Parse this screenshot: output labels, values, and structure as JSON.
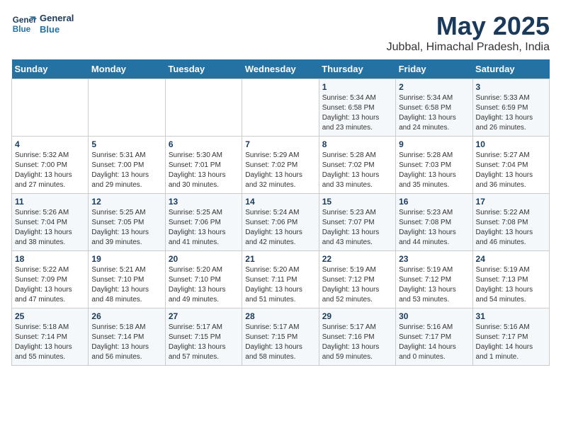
{
  "header": {
    "logo_line1": "General",
    "logo_line2": "Blue",
    "title": "May 2025",
    "subtitle": "Jubbal, Himachal Pradesh, India"
  },
  "calendar": {
    "days_of_week": [
      "Sunday",
      "Monday",
      "Tuesday",
      "Wednesday",
      "Thursday",
      "Friday",
      "Saturday"
    ],
    "weeks": [
      [
        {
          "day": "",
          "info": ""
        },
        {
          "day": "",
          "info": ""
        },
        {
          "day": "",
          "info": ""
        },
        {
          "day": "",
          "info": ""
        },
        {
          "day": "1",
          "info": "Sunrise: 5:34 AM\nSunset: 6:58 PM\nDaylight: 13 hours\nand 23 minutes."
        },
        {
          "day": "2",
          "info": "Sunrise: 5:34 AM\nSunset: 6:58 PM\nDaylight: 13 hours\nand 24 minutes."
        },
        {
          "day": "3",
          "info": "Sunrise: 5:33 AM\nSunset: 6:59 PM\nDaylight: 13 hours\nand 26 minutes."
        }
      ],
      [
        {
          "day": "4",
          "info": "Sunrise: 5:32 AM\nSunset: 7:00 PM\nDaylight: 13 hours\nand 27 minutes."
        },
        {
          "day": "5",
          "info": "Sunrise: 5:31 AM\nSunset: 7:00 PM\nDaylight: 13 hours\nand 29 minutes."
        },
        {
          "day": "6",
          "info": "Sunrise: 5:30 AM\nSunset: 7:01 PM\nDaylight: 13 hours\nand 30 minutes."
        },
        {
          "day": "7",
          "info": "Sunrise: 5:29 AM\nSunset: 7:02 PM\nDaylight: 13 hours\nand 32 minutes."
        },
        {
          "day": "8",
          "info": "Sunrise: 5:28 AM\nSunset: 7:02 PM\nDaylight: 13 hours\nand 33 minutes."
        },
        {
          "day": "9",
          "info": "Sunrise: 5:28 AM\nSunset: 7:03 PM\nDaylight: 13 hours\nand 35 minutes."
        },
        {
          "day": "10",
          "info": "Sunrise: 5:27 AM\nSunset: 7:04 PM\nDaylight: 13 hours\nand 36 minutes."
        }
      ],
      [
        {
          "day": "11",
          "info": "Sunrise: 5:26 AM\nSunset: 7:04 PM\nDaylight: 13 hours\nand 38 minutes."
        },
        {
          "day": "12",
          "info": "Sunrise: 5:25 AM\nSunset: 7:05 PM\nDaylight: 13 hours\nand 39 minutes."
        },
        {
          "day": "13",
          "info": "Sunrise: 5:25 AM\nSunset: 7:06 PM\nDaylight: 13 hours\nand 41 minutes."
        },
        {
          "day": "14",
          "info": "Sunrise: 5:24 AM\nSunset: 7:06 PM\nDaylight: 13 hours\nand 42 minutes."
        },
        {
          "day": "15",
          "info": "Sunrise: 5:23 AM\nSunset: 7:07 PM\nDaylight: 13 hours\nand 43 minutes."
        },
        {
          "day": "16",
          "info": "Sunrise: 5:23 AM\nSunset: 7:08 PM\nDaylight: 13 hours\nand 44 minutes."
        },
        {
          "day": "17",
          "info": "Sunrise: 5:22 AM\nSunset: 7:08 PM\nDaylight: 13 hours\nand 46 minutes."
        }
      ],
      [
        {
          "day": "18",
          "info": "Sunrise: 5:22 AM\nSunset: 7:09 PM\nDaylight: 13 hours\nand 47 minutes."
        },
        {
          "day": "19",
          "info": "Sunrise: 5:21 AM\nSunset: 7:10 PM\nDaylight: 13 hours\nand 48 minutes."
        },
        {
          "day": "20",
          "info": "Sunrise: 5:20 AM\nSunset: 7:10 PM\nDaylight: 13 hours\nand 49 minutes."
        },
        {
          "day": "21",
          "info": "Sunrise: 5:20 AM\nSunset: 7:11 PM\nDaylight: 13 hours\nand 51 minutes."
        },
        {
          "day": "22",
          "info": "Sunrise: 5:19 AM\nSunset: 7:12 PM\nDaylight: 13 hours\nand 52 minutes."
        },
        {
          "day": "23",
          "info": "Sunrise: 5:19 AM\nSunset: 7:12 PM\nDaylight: 13 hours\nand 53 minutes."
        },
        {
          "day": "24",
          "info": "Sunrise: 5:19 AM\nSunset: 7:13 PM\nDaylight: 13 hours\nand 54 minutes."
        }
      ],
      [
        {
          "day": "25",
          "info": "Sunrise: 5:18 AM\nSunset: 7:14 PM\nDaylight: 13 hours\nand 55 minutes."
        },
        {
          "day": "26",
          "info": "Sunrise: 5:18 AM\nSunset: 7:14 PM\nDaylight: 13 hours\nand 56 minutes."
        },
        {
          "day": "27",
          "info": "Sunrise: 5:17 AM\nSunset: 7:15 PM\nDaylight: 13 hours\nand 57 minutes."
        },
        {
          "day": "28",
          "info": "Sunrise: 5:17 AM\nSunset: 7:15 PM\nDaylight: 13 hours\nand 58 minutes."
        },
        {
          "day": "29",
          "info": "Sunrise: 5:17 AM\nSunset: 7:16 PM\nDaylight: 13 hours\nand 59 minutes."
        },
        {
          "day": "30",
          "info": "Sunrise: 5:16 AM\nSunset: 7:17 PM\nDaylight: 14 hours\nand 0 minutes."
        },
        {
          "day": "31",
          "info": "Sunrise: 5:16 AM\nSunset: 7:17 PM\nDaylight: 14 hours\nand 1 minute."
        }
      ]
    ]
  }
}
